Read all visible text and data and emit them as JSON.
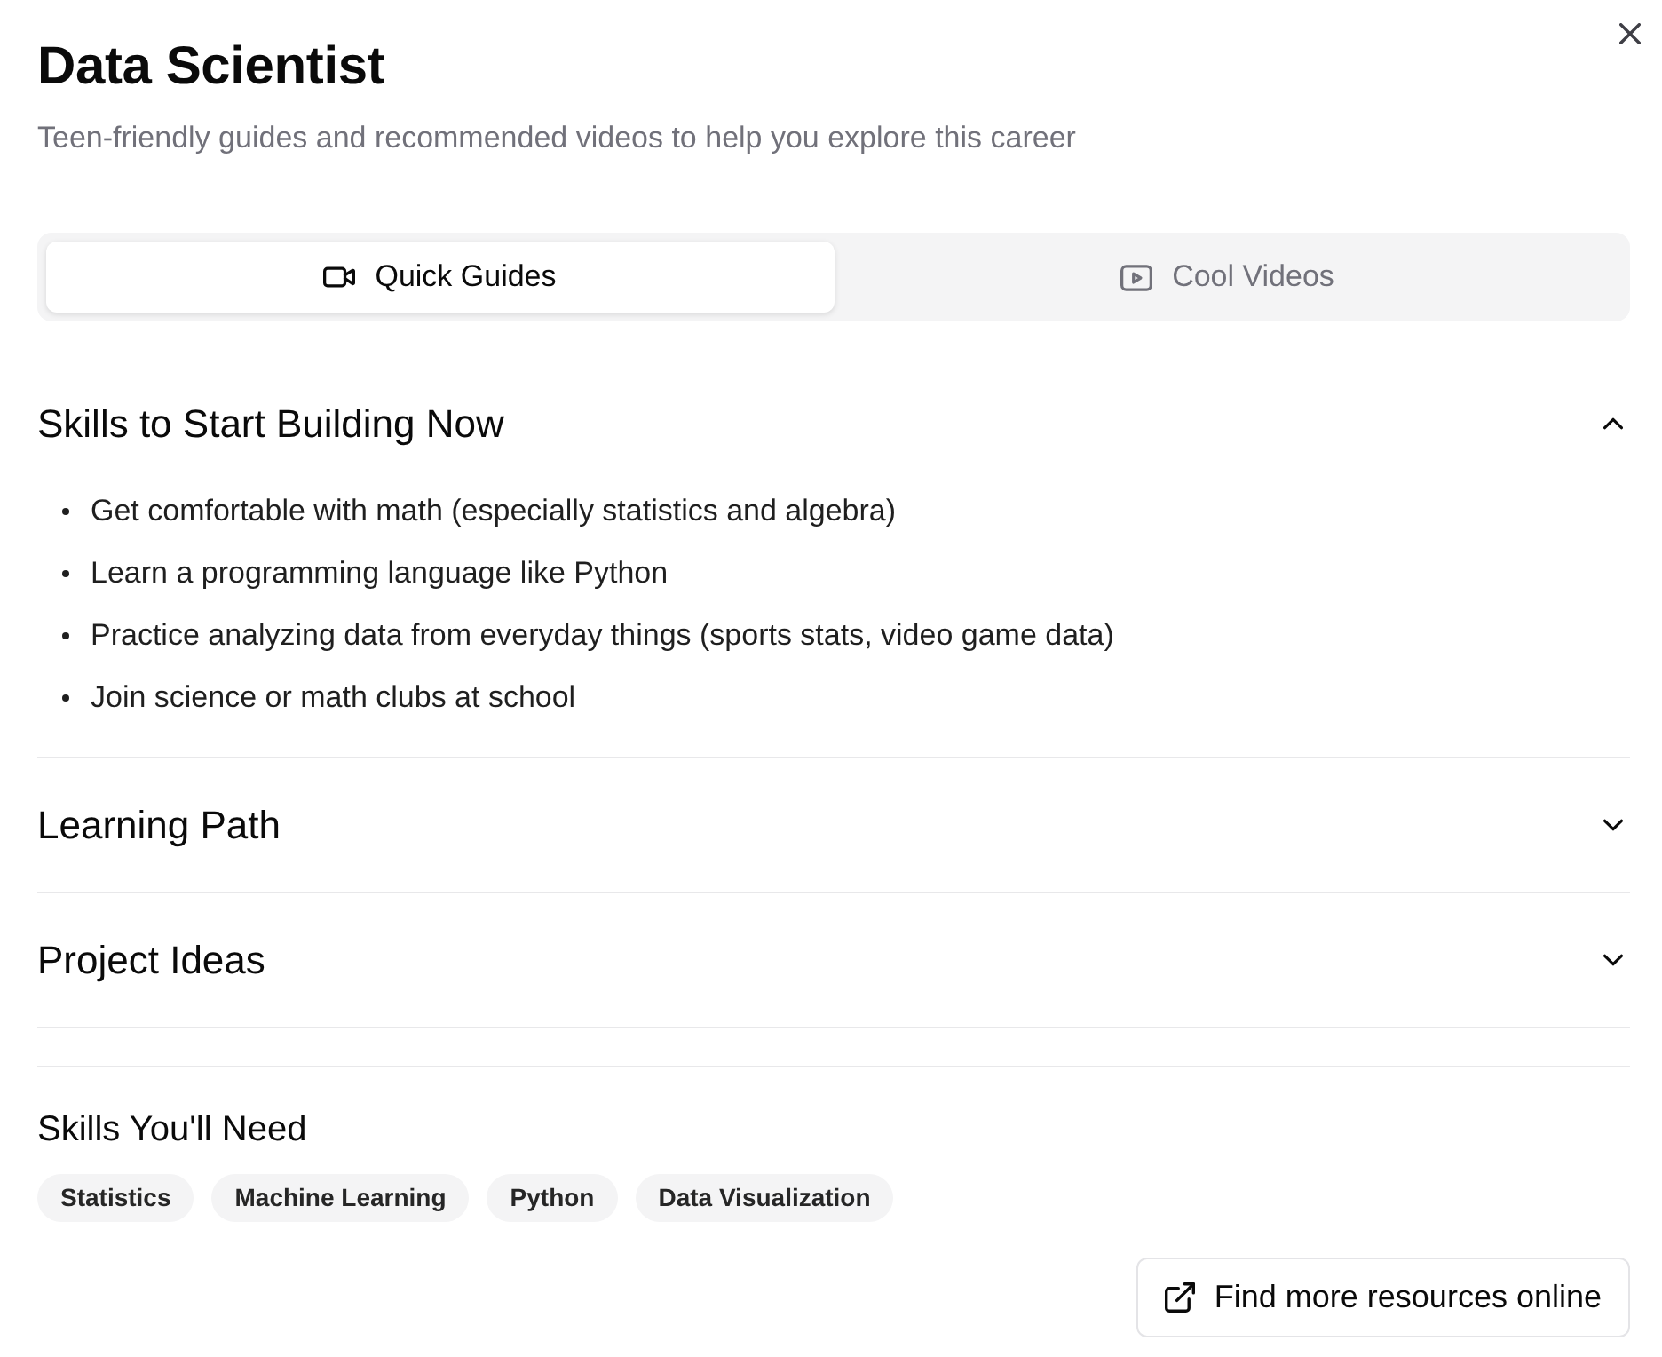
{
  "dialog": {
    "title": "Data Scientist",
    "subtitle": "Teen-friendly guides and recommended videos to help you explore this career"
  },
  "tabs": [
    {
      "label": "Quick Guides",
      "selected": true
    },
    {
      "label": "Cool Videos",
      "selected": false
    }
  ],
  "accordion": [
    {
      "title": "Skills to Start Building Now",
      "expanded": true,
      "items": [
        "Get comfortable with math (especially statistics and algebra)",
        "Learn a programming language like Python",
        "Practice analyzing data from everyday things (sports stats, video game data)",
        "Join science or math clubs at school"
      ]
    },
    {
      "title": "Learning Path",
      "expanded": false
    },
    {
      "title": "Project Ideas",
      "expanded": false
    }
  ],
  "skills": {
    "heading": "Skills You'll Need",
    "tags": [
      "Statistics",
      "Machine Learning",
      "Python",
      "Data Visualization"
    ]
  },
  "resources_button": {
    "label": "Find more resources online"
  }
}
